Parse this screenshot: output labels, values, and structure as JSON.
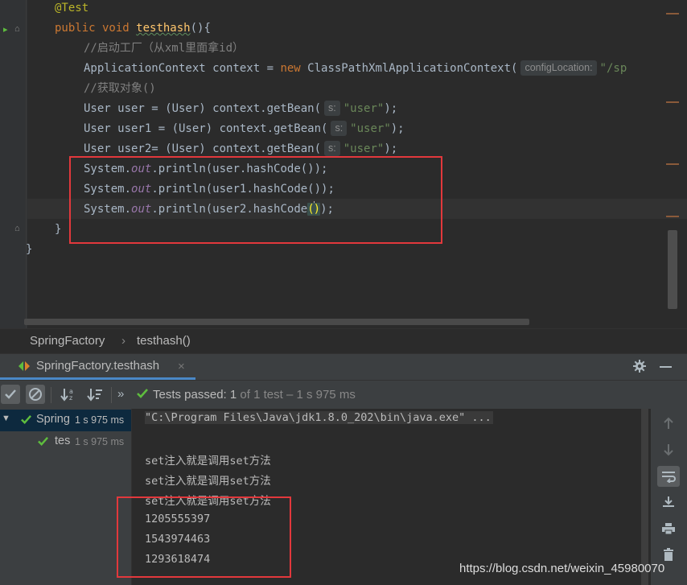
{
  "editor": {
    "annotation": "@Test",
    "method_kw": "public void ",
    "method_name": "testhash",
    "method_tail": "(){",
    "comment1": "//启动工厂（从xml里面拿id）",
    "ctx_type": "ApplicationContext context = ",
    "new_kw": "new ",
    "ctx_class": "ClassPathXmlApplicationContext(",
    "ctx_hint": "configLocation:",
    "ctx_arg": "\"/sp",
    "comment2": "//获取对象()",
    "get1_prefix": "User user = (User) context.getBean(",
    "get2_prefix": "User user1 = (User) context.getBean(",
    "get3_prefix": "User user2= (User) context.getBean(",
    "s_hint": "s:",
    "arg_user": "\"user\"",
    "arg_tail": ");",
    "sys_prefix": "System.",
    "out_field": "out",
    "print1": ".println(user.hashCode());",
    "print2": ".println(user1.hashCode());",
    "print3_a": ".println(user2.hashCode",
    "print3_open": "(",
    "print3_close": ")",
    "print3_b": ");",
    "close_method": "}",
    "close_class": "}"
  },
  "breadcrumb": {
    "class_name": "SpringFactory",
    "separator": "›",
    "method_name": "testhash()"
  },
  "run_tab": {
    "title": "SpringFactory.testhash",
    "close": "×"
  },
  "toolbar": {
    "more": "»",
    "status_label": "Tests passed:",
    "status_count": "1",
    "status_rest": "of 1 test – 1 s 975 ms"
  },
  "tree": {
    "items": [
      {
        "label": "Spring",
        "time": "1 s 975 ms"
      },
      {
        "label": "tes",
        "time": "1 s 975 ms"
      }
    ]
  },
  "console": {
    "lines": [
      "\"C:\\Program Files\\Java\\jdk1.8.0_202\\bin\\java.exe\" ...",
      "",
      "set注入就是调用set方法",
      "set注入就是调用set方法",
      "set注入就是调用set方法",
      "1205555397",
      "1543974463",
      "1293618474"
    ]
  },
  "watermark": "https://blog.csdn.net/weixin_45980070",
  "colors": {
    "highlight_box": "#e2383c",
    "pass_green": "#5ebd3e",
    "keyword": "#cc7832",
    "string": "#6a8759"
  },
  "icons": [
    "run-gutter-icon",
    "checkmark-icon",
    "ignored-icon",
    "sort-alpha-icon",
    "sort-duration-icon",
    "gear-icon",
    "minimize-icon",
    "up-arrow-icon",
    "down-arrow-icon",
    "soft-wrap-icon",
    "scroll-to-end-icon",
    "print-icon",
    "trash-icon"
  ]
}
